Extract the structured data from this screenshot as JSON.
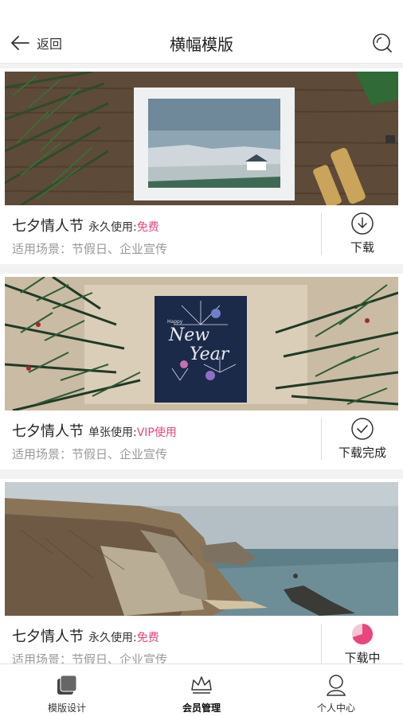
{
  "header": {
    "back_label": "返回",
    "title": "横幅模版"
  },
  "templates": [
    {
      "name": "七夕情人节",
      "usage_label": "永久使用:",
      "usage_value": "免费",
      "scene": "适用场景：节假日、企业宣传",
      "action_label": "下载",
      "action_icon": "download-icon"
    },
    {
      "name": "七夕情人节",
      "usage_label": "单张使用:",
      "usage_value": "VIP使用",
      "scene": "适用场景：节假日、企业宣传",
      "action_label": "下载完成",
      "action_icon": "check-circle-icon"
    },
    {
      "name": "七夕情人节",
      "usage_label": "永久使用:",
      "usage_value": "免费",
      "scene": "适用场景：节假日、企业宣传",
      "action_label": "下载中",
      "action_icon": "progress-pie-icon",
      "progress": 0.7
    }
  ],
  "photo_text": {
    "card2_small": "Happy",
    "card2_line1": "New",
    "card2_line2": "Year"
  },
  "tabbar": {
    "items": [
      {
        "label": "模版设计",
        "icon": "layers-icon"
      },
      {
        "label": "会员管理",
        "icon": "crown-icon"
      },
      {
        "label": "个人中心",
        "icon": "user-icon"
      }
    ]
  },
  "colors": {
    "accent": "#e8467c",
    "divider": "#dcdcdc",
    "background": "#f2f2f2"
  }
}
